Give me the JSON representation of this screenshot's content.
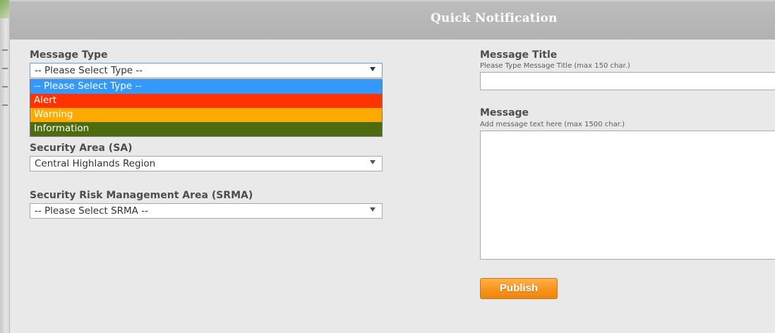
{
  "header": {
    "title": "Quick Notification"
  },
  "message_type": {
    "label": "Message Type",
    "selected": "-- Please Select Type --",
    "options": [
      {
        "label": "-- Please Select Type --",
        "color": "#3399ff"
      },
      {
        "label": "Alert",
        "color": "#ff3300"
      },
      {
        "label": "Warning",
        "color": "#ffaa00"
      },
      {
        "label": "Information",
        "color": "#4d6b0f"
      }
    ]
  },
  "security_area": {
    "label": "Security Area (SA)",
    "selected": "Central Highlands Region"
  },
  "srma": {
    "label": "Security Risk Management Area (SRMA)",
    "selected": "-- Please Select SRMA --"
  },
  "message_title": {
    "label": "Message Title",
    "hint": "Please Type Message Title (max 150 char.)",
    "value": ""
  },
  "message": {
    "label": "Message",
    "hint": "Add message text here (max 1500 char.)",
    "value": ""
  },
  "actions": {
    "publish_label": "Publish"
  },
  "colors": {
    "header_bg": "#b5b5b5",
    "panel_bg": "#e9e9e9",
    "publish": "#f7941d"
  }
}
